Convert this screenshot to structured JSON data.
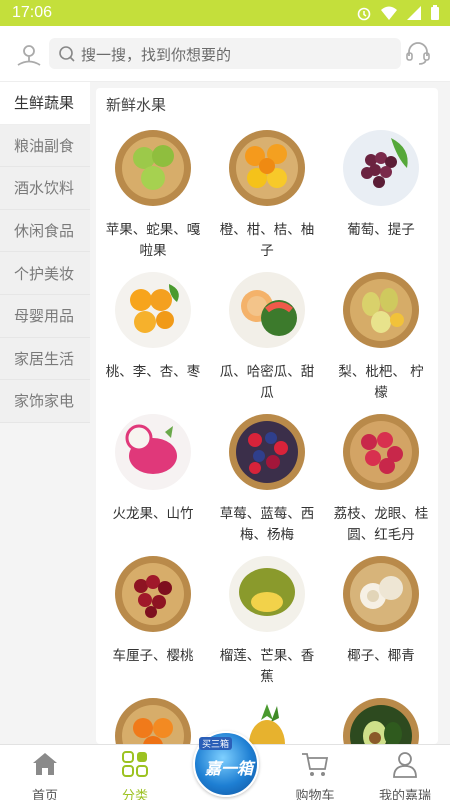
{
  "status": {
    "time": "17:06"
  },
  "search": {
    "placeholder": "搜一搜，找到你想要的"
  },
  "sidebar": {
    "items": [
      {
        "label": "生鲜蔬果",
        "active": true
      },
      {
        "label": "粮油副食"
      },
      {
        "label": "酒水饮料"
      },
      {
        "label": "休闲食品"
      },
      {
        "label": "个护美妆"
      },
      {
        "label": "母婴用品"
      },
      {
        "label": "家居生活"
      },
      {
        "label": "家饰家电"
      }
    ]
  },
  "content": {
    "section_title": "新鲜水果",
    "items": [
      {
        "label": "苹果、蛇果、嘎啦果",
        "icon": "apple-basket-icon"
      },
      {
        "label": "橙、柑、桔、柚子",
        "icon": "orange-basket-icon"
      },
      {
        "label": "葡萄、提子",
        "icon": "grape-basket-icon"
      },
      {
        "label": "桃、李、杏、枣",
        "icon": "apricot-plate-icon"
      },
      {
        "label": "瓜、哈密瓜、甜瓜",
        "icon": "melon-plate-icon"
      },
      {
        "label": "梨、枇杷、 柠檬",
        "icon": "pear-basket-icon"
      },
      {
        "label": "火龙果、山竹",
        "icon": "dragonfruit-plate-icon"
      },
      {
        "label": "草莓、蓝莓、西梅、杨梅",
        "icon": "berry-basket-icon"
      },
      {
        "label": "荔枝、龙眼、桂圆、红毛丹",
        "icon": "lychee-basket-icon"
      },
      {
        "label": "车厘子、樱桃",
        "icon": "cherry-basket-icon"
      },
      {
        "label": "榴莲、芒果、香蕉",
        "icon": "durian-plate-icon"
      },
      {
        "label": "椰子、椰青",
        "icon": "coconut-basket-icon"
      },
      {
        "label": "",
        "icon": "persimmon-basket-icon"
      },
      {
        "label": "",
        "icon": "pineapple-icon"
      },
      {
        "label": "",
        "icon": "avocado-basket-icon"
      }
    ]
  },
  "tabs": [
    {
      "label": "首页",
      "icon": "home-icon"
    },
    {
      "label": "分类",
      "icon": "category-grid-icon",
      "active": true
    },
    {
      "label": "",
      "icon": "promo-badge-icon",
      "badge_top": "买三箱",
      "badge_text": "嘉一箱"
    },
    {
      "label": "购物车",
      "icon": "cart-icon"
    },
    {
      "label": "我的嘉瑞",
      "icon": "user-icon"
    }
  ],
  "colors": {
    "accent": "#c4df3b",
    "active_tab": "#9cc221"
  }
}
